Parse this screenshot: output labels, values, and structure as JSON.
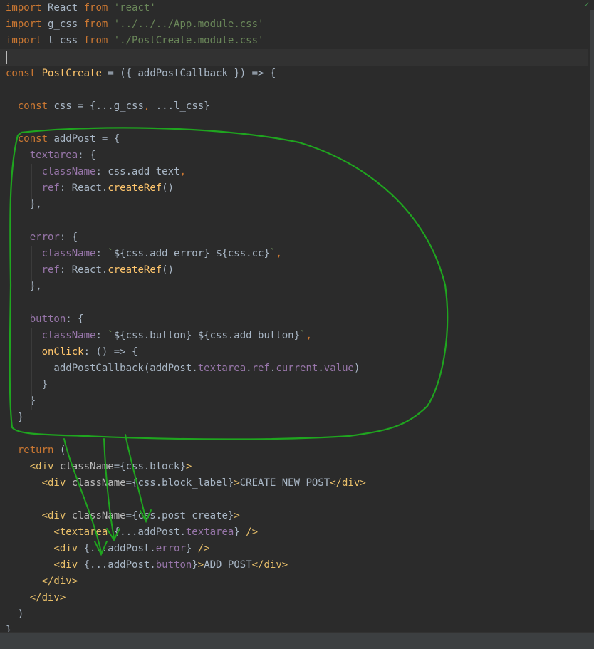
{
  "editor": {
    "lines": [
      {
        "tokens": [
          {
            "t": "import",
            "c": "kw"
          },
          {
            "t": " React ",
            "c": "txt"
          },
          {
            "t": "from",
            "c": "kw"
          },
          {
            "t": " ",
            "c": "txt"
          },
          {
            "t": "'react'",
            "c": "str"
          }
        ]
      },
      {
        "tokens": [
          {
            "t": "import",
            "c": "kw"
          },
          {
            "t": " g_css ",
            "c": "txt"
          },
          {
            "t": "from",
            "c": "kw"
          },
          {
            "t": " ",
            "c": "txt"
          },
          {
            "t": "'../../../App.module.css'",
            "c": "str"
          }
        ]
      },
      {
        "tokens": [
          {
            "t": "import",
            "c": "kw"
          },
          {
            "t": " l_css ",
            "c": "txt"
          },
          {
            "t": "from",
            "c": "kw"
          },
          {
            "t": " ",
            "c": "txt"
          },
          {
            "t": "'./PostCreate.module.css'",
            "c": "str"
          }
        ]
      },
      {
        "tokens": [],
        "current": true
      },
      {
        "tokens": [
          {
            "t": "const",
            "c": "kw"
          },
          {
            "t": " ",
            "c": "txt"
          },
          {
            "t": "PostCreate",
            "c": "fn"
          },
          {
            "t": " = ({ addPostCallback }) => {",
            "c": "txt"
          }
        ]
      },
      {
        "tokens": []
      },
      {
        "tokens": [
          {
            "t": "  ",
            "c": "txt"
          },
          {
            "t": "const",
            "c": "kw"
          },
          {
            "t": " css = {...g_css",
            "c": "txt"
          },
          {
            "t": ",",
            "c": "kw"
          },
          {
            "t": " ...l_css}",
            "c": "txt"
          }
        ]
      },
      {
        "tokens": []
      },
      {
        "tokens": [
          {
            "t": "  ",
            "c": "txt"
          },
          {
            "t": "const",
            "c": "kw"
          },
          {
            "t": " addPost = {",
            "c": "txt"
          }
        ]
      },
      {
        "tokens": [
          {
            "t": "    ",
            "c": "txt"
          },
          {
            "t": "textarea",
            "c": "prop"
          },
          {
            "t": ": {",
            "c": "txt"
          }
        ]
      },
      {
        "tokens": [
          {
            "t": "      ",
            "c": "txt"
          },
          {
            "t": "className",
            "c": "prop"
          },
          {
            "t": ": css.add_text",
            "c": "txt"
          },
          {
            "t": ",",
            "c": "kw"
          }
        ]
      },
      {
        "tokens": [
          {
            "t": "      ",
            "c": "txt"
          },
          {
            "t": "ref",
            "c": "prop"
          },
          {
            "t": ": React.",
            "c": "txt"
          },
          {
            "t": "createRef",
            "c": "fn"
          },
          {
            "t": "()",
            "c": "txt"
          }
        ]
      },
      {
        "tokens": [
          {
            "t": "    },",
            "c": "txt"
          }
        ]
      },
      {
        "tokens": []
      },
      {
        "tokens": [
          {
            "t": "    ",
            "c": "txt"
          },
          {
            "t": "error",
            "c": "prop"
          },
          {
            "t": ": {",
            "c": "txt"
          }
        ]
      },
      {
        "tokens": [
          {
            "t": "      ",
            "c": "txt"
          },
          {
            "t": "className",
            "c": "prop"
          },
          {
            "t": ": ",
            "c": "txt"
          },
          {
            "t": "`",
            "c": "str"
          },
          {
            "t": "${css.add_error} ${css.cc}",
            "c": "txt"
          },
          {
            "t": "`",
            "c": "str"
          },
          {
            "t": ",",
            "c": "kw"
          }
        ]
      },
      {
        "tokens": [
          {
            "t": "      ",
            "c": "txt"
          },
          {
            "t": "ref",
            "c": "prop"
          },
          {
            "t": ": React.",
            "c": "txt"
          },
          {
            "t": "createRef",
            "c": "fn"
          },
          {
            "t": "()",
            "c": "txt"
          }
        ]
      },
      {
        "tokens": [
          {
            "t": "    },",
            "c": "txt"
          }
        ]
      },
      {
        "tokens": []
      },
      {
        "tokens": [
          {
            "t": "    ",
            "c": "txt"
          },
          {
            "t": "button",
            "c": "prop"
          },
          {
            "t": ": {",
            "c": "txt"
          }
        ]
      },
      {
        "tokens": [
          {
            "t": "      ",
            "c": "txt"
          },
          {
            "t": "className",
            "c": "prop"
          },
          {
            "t": ": ",
            "c": "txt"
          },
          {
            "t": "`",
            "c": "str"
          },
          {
            "t": "${css.button} ${css.add_button}",
            "c": "txt"
          },
          {
            "t": "`",
            "c": "str"
          },
          {
            "t": ",",
            "c": "kw"
          }
        ]
      },
      {
        "tokens": [
          {
            "t": "      ",
            "c": "txt"
          },
          {
            "t": "onClick",
            "c": "fn"
          },
          {
            "t": ": () => {",
            "c": "txt"
          }
        ]
      },
      {
        "tokens": [
          {
            "t": "        addPostCallback(addPost.",
            "c": "txt"
          },
          {
            "t": "textarea",
            "c": "prop"
          },
          {
            "t": ".",
            "c": "txt"
          },
          {
            "t": "ref",
            "c": "prop"
          },
          {
            "t": ".",
            "c": "txt"
          },
          {
            "t": "current",
            "c": "prop"
          },
          {
            "t": ".",
            "c": "txt"
          },
          {
            "t": "value",
            "c": "prop"
          },
          {
            "t": ")",
            "c": "txt"
          }
        ]
      },
      {
        "tokens": [
          {
            "t": "      }",
            "c": "txt"
          }
        ]
      },
      {
        "tokens": [
          {
            "t": "    }",
            "c": "txt"
          }
        ]
      },
      {
        "tokens": [
          {
            "t": "  }",
            "c": "txt"
          }
        ]
      },
      {
        "tokens": []
      },
      {
        "tokens": [
          {
            "t": "  ",
            "c": "txt"
          },
          {
            "t": "return",
            "c": "kw"
          },
          {
            "t": " (",
            "c": "txt"
          }
        ]
      },
      {
        "tokens": [
          {
            "t": "    ",
            "c": "txt"
          },
          {
            "t": "<div",
            "c": "tag"
          },
          {
            "t": " ",
            "c": "txt"
          },
          {
            "t": "className",
            "c": "attr"
          },
          {
            "t": "={css.block}",
            "c": "txt"
          },
          {
            "t": ">",
            "c": "tag"
          }
        ]
      },
      {
        "tokens": [
          {
            "t": "      ",
            "c": "txt"
          },
          {
            "t": "<div",
            "c": "tag"
          },
          {
            "t": " ",
            "c": "txt"
          },
          {
            "t": "className",
            "c": "attr"
          },
          {
            "t": "={css.block_label}",
            "c": "txt"
          },
          {
            "t": ">",
            "c": "tag"
          },
          {
            "t": "CREATE NEW POST",
            "c": "txt"
          },
          {
            "t": "</div>",
            "c": "tag"
          }
        ]
      },
      {
        "tokens": []
      },
      {
        "tokens": [
          {
            "t": "      ",
            "c": "txt"
          },
          {
            "t": "<div",
            "c": "tag"
          },
          {
            "t": " ",
            "c": "txt"
          },
          {
            "t": "className",
            "c": "attr"
          },
          {
            "t": "={css.post_create}",
            "c": "txt"
          },
          {
            "t": ">",
            "c": "tag"
          }
        ]
      },
      {
        "tokens": [
          {
            "t": "        ",
            "c": "txt"
          },
          {
            "t": "<textarea",
            "c": "tag"
          },
          {
            "t": " {...addPost.",
            "c": "txt"
          },
          {
            "t": "textarea",
            "c": "prop"
          },
          {
            "t": "} ",
            "c": "txt"
          },
          {
            "t": "/>",
            "c": "tag"
          }
        ]
      },
      {
        "tokens": [
          {
            "t": "        ",
            "c": "txt"
          },
          {
            "t": "<div",
            "c": "tag"
          },
          {
            "t": " {...addPost.",
            "c": "txt"
          },
          {
            "t": "error",
            "c": "prop"
          },
          {
            "t": "} ",
            "c": "txt"
          },
          {
            "t": "/>",
            "c": "tag"
          }
        ]
      },
      {
        "tokens": [
          {
            "t": "        ",
            "c": "txt"
          },
          {
            "t": "<div",
            "c": "tag"
          },
          {
            "t": " {...addPost.",
            "c": "txt"
          },
          {
            "t": "button",
            "c": "prop"
          },
          {
            "t": "}",
            "c": "txt"
          },
          {
            "t": ">",
            "c": "tag"
          },
          {
            "t": "ADD POST",
            "c": "txt"
          },
          {
            "t": "</div>",
            "c": "tag"
          }
        ]
      },
      {
        "tokens": [
          {
            "t": "      ",
            "c": "txt"
          },
          {
            "t": "</div>",
            "c": "tag"
          }
        ]
      },
      {
        "tokens": [
          {
            "t": "    ",
            "c": "txt"
          },
          {
            "t": "</div>",
            "c": "tag"
          }
        ]
      },
      {
        "tokens": [
          {
            "t": "  )",
            "c": "txt"
          }
        ]
      },
      {
        "tokens": [
          {
            "t": "}",
            "c": "txt"
          }
        ]
      }
    ]
  },
  "colors": {
    "background": "#2b2b2b",
    "keyword": "#cc7832",
    "string": "#6a8759",
    "function": "#ffc66d",
    "property": "#9876aa",
    "tag": "#e8bf6a",
    "annotation": "#1fa51f"
  },
  "icons": {
    "inspection_status": "check-icon"
  }
}
